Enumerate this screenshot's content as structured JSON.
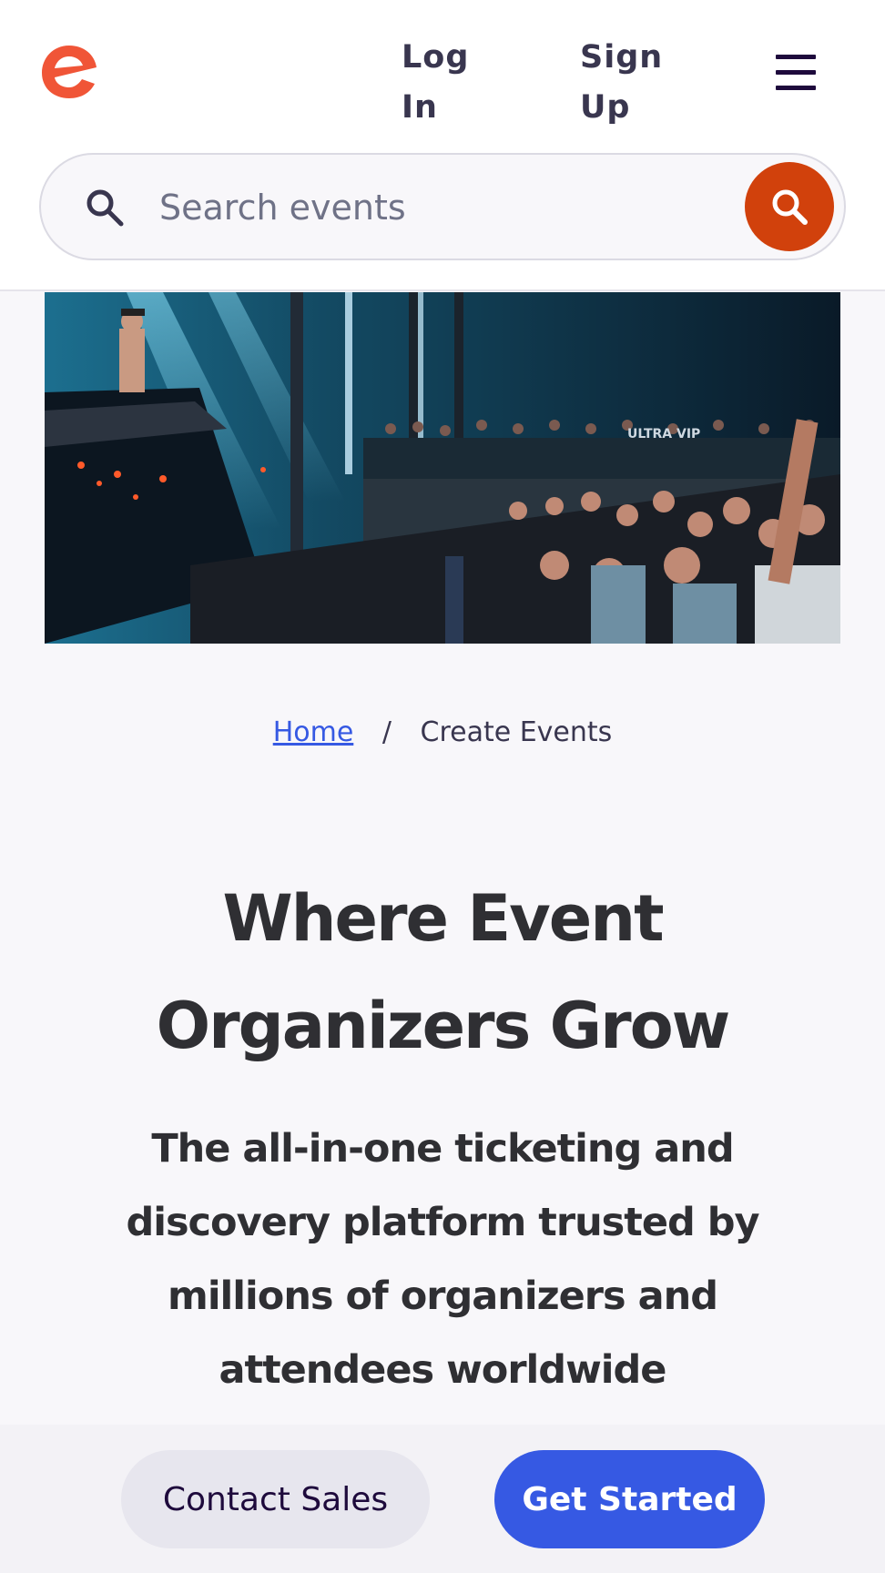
{
  "header": {
    "logo_name": "eventbrite-logo",
    "login_line1": "Log",
    "login_line2": "In",
    "signup_line1": "Sign",
    "signup_line2": "Up",
    "menu_icon": "hamburger-menu-icon"
  },
  "search": {
    "placeholder": "Search events",
    "icon": "search-icon",
    "button_icon": "search-icon"
  },
  "hero": {
    "image_subject": "concert crowd and DJ stage",
    "banner_text": "ULTRA VIP"
  },
  "breadcrumb": {
    "home": "Home",
    "separator": "/",
    "current": "Create Events"
  },
  "main": {
    "headline_line1": "Where Event",
    "headline_line2": "Organizers Grow",
    "subtitle": "The all-in-one ticketing and discovery platform trusted by millions of organizers and attendees worldwide"
  },
  "actions": {
    "contact_sales": "Contact Sales",
    "get_started": "Get Started"
  },
  "colors": {
    "brand_orange": "#f05537",
    "search_button": "#d1410c",
    "primary_blue": "#3659e3",
    "text_dark": "#39364f"
  }
}
